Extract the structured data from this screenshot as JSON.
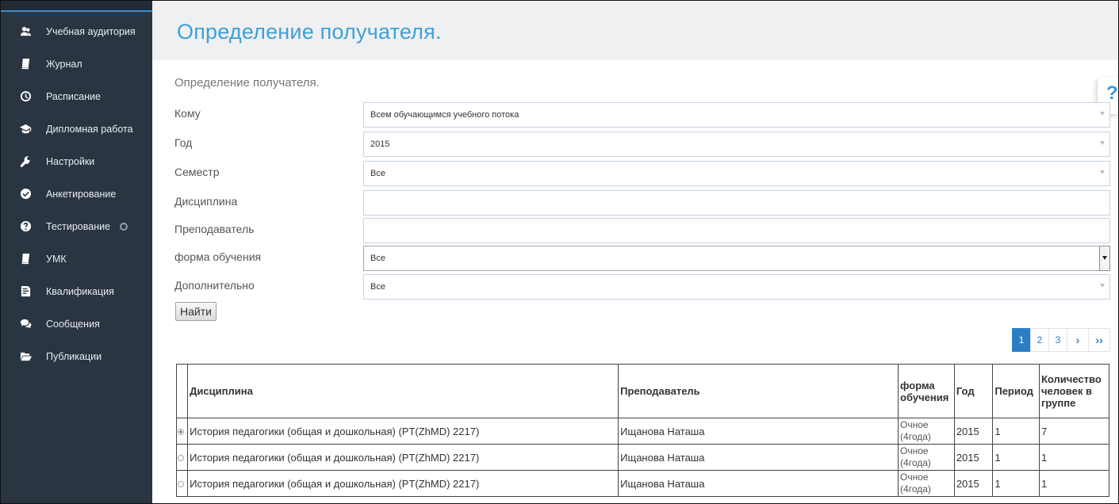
{
  "sidebar": {
    "items": [
      {
        "label": "Учебная аудитория",
        "icon": "users-icon"
      },
      {
        "label": "Журнал",
        "icon": "book-icon"
      },
      {
        "label": "Расписание",
        "icon": "clock-icon"
      },
      {
        "label": "Дипломная работа",
        "icon": "graduation-cap-icon"
      },
      {
        "label": "Настройки",
        "icon": "wrench-icon"
      },
      {
        "label": "Анкетирование",
        "icon": "check-circle-icon"
      },
      {
        "label": "Тестирование",
        "icon": "question-circle-icon"
      },
      {
        "label": "УМК",
        "icon": "book-icon"
      },
      {
        "label": "Квалификация",
        "icon": "certificate-icon"
      },
      {
        "label": "Сообщения",
        "icon": "comments-icon"
      },
      {
        "label": "Публикации",
        "icon": "folder-open-icon"
      }
    ]
  },
  "header": {
    "title": "Определение получателя."
  },
  "form": {
    "section_title": "Определение получателя.",
    "fields": {
      "komu": {
        "label": "Кому",
        "value": "Всем обучающимся учебного потока"
      },
      "god": {
        "label": "Год",
        "value": "2015"
      },
      "semestr": {
        "label": "Семестр",
        "value": "Все"
      },
      "disciplina": {
        "label": "Дисциплина",
        "value": ""
      },
      "prepodavatel": {
        "label": "Преподаватель",
        "value": ""
      },
      "forma": {
        "label": "форма обучения",
        "value": "Все"
      },
      "dop": {
        "label": "Дополнительно",
        "value": "Все"
      }
    },
    "find_button": "Найти"
  },
  "pagination": {
    "pages": [
      "1",
      "2",
      "3"
    ],
    "next": "›",
    "last": "››",
    "current": "1"
  },
  "table": {
    "headers": {
      "discipline": "Дисциплина",
      "teacher": "Преподаватель",
      "form": "форма обучения",
      "year": "Год",
      "period": "Период",
      "count": "Количество человек в группе"
    },
    "rows": [
      {
        "discipline": "История педагогики (общая и дошкольная) (PT(ZhMD) 2217)",
        "teacher": "Ищанова Наташа",
        "form": "Очное (4года)",
        "year": "2015",
        "period": "1",
        "count": "7",
        "selected": true
      },
      {
        "discipline": "История педагогики (общая и дошкольная) (PT(ZhMD) 2217)",
        "teacher": "Ищанова Наташа",
        "form": "Очное (4года)",
        "year": "2015",
        "period": "1",
        "count": "1",
        "selected": false
      },
      {
        "discipline": "История педагогики (общая и дошкольная) (PT(ZhMD) 2217)",
        "teacher": "Ищанова Наташа",
        "form": "Очное (4года)",
        "year": "2015",
        "period": "1",
        "count": "1",
        "selected": false
      }
    ]
  },
  "colors": {
    "sidebar_bg": "#2a3542",
    "accent": "#3fa0d6",
    "pagination_active": "#2a7fc4"
  }
}
